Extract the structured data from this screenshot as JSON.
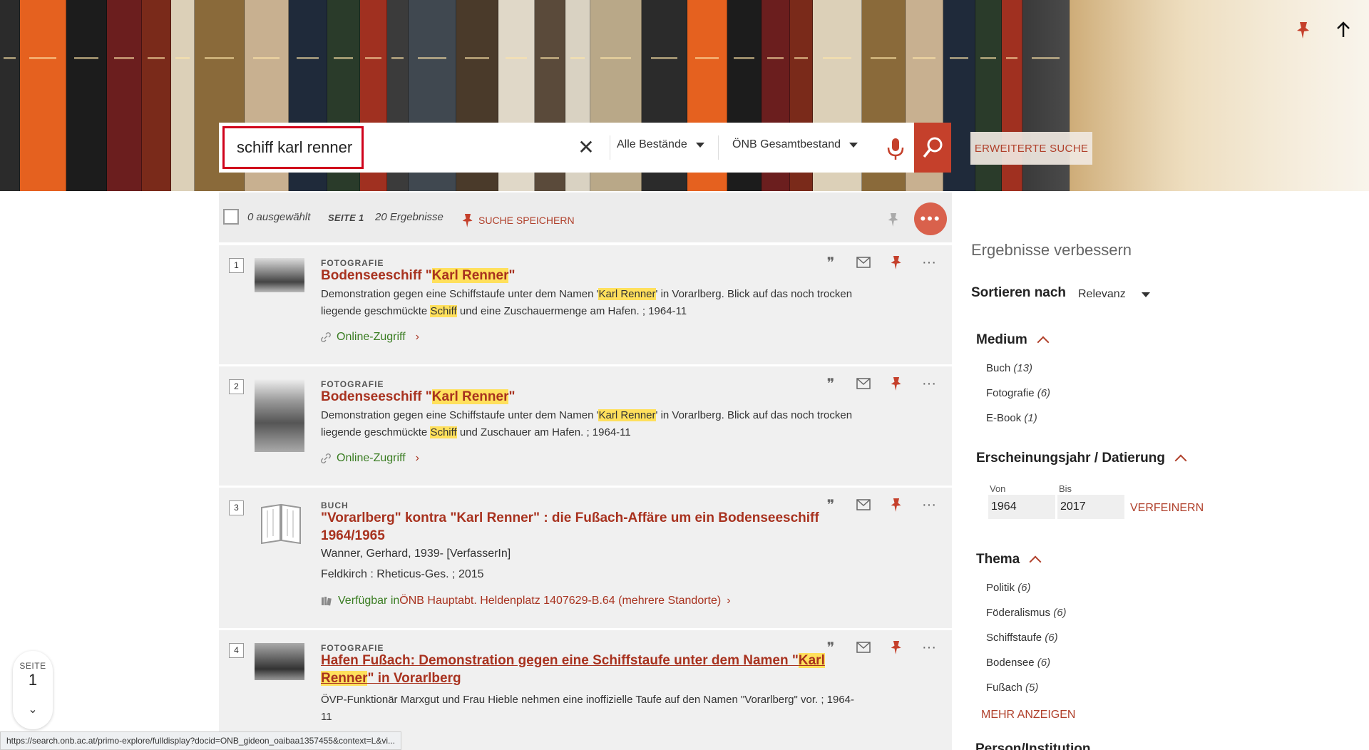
{
  "search": {
    "query": "schiff karl renner",
    "scope1": "Alle Bestände",
    "scope2": "ÖNB Gesamtbestand",
    "advanced_label": "ERWEITERTE SUCHE"
  },
  "toolbar": {
    "selected": "0 ausgewählt",
    "page": "SEITE 1",
    "count": "20 Ergebnisse",
    "save_search": "SUCHE SPEICHERN"
  },
  "results": [
    {
      "num": "1",
      "type": "FOTOGRAFIE",
      "title_pre": "Bodenseeschiff \"",
      "title_hl": "Karl Renner",
      "title_post": "\"",
      "desc1_pre": "Demonstration gegen eine Schiffstaufe unter dem Namen '",
      "desc1_hl": "Karl Renner",
      "desc1_post": "' in Vorarlberg. Blick auf das noch trocken",
      "desc2_pre": "liegende geschmückte ",
      "desc2_hl": "Schiff",
      "desc2_post": " und eine Zuschauermenge am Hafen. ; 1964-11",
      "link": "Online-Zugriff"
    },
    {
      "num": "2",
      "type": "FOTOGRAFIE",
      "title_pre": "Bodenseeschiff \"",
      "title_hl": "Karl Renner",
      "title_post": "\"",
      "desc1_pre": "Demonstration gegen eine Schiffstaufe unter dem Namen '",
      "desc1_hl": "Karl Renner",
      "desc1_post": "' in Vorarlberg. Blick auf das noch trocken",
      "desc2_pre": "liegende geschmückte ",
      "desc2_hl": "Schiff",
      "desc2_post": " und Zuschauer am Hafen. ; 1964-11",
      "link": "Online-Zugriff"
    },
    {
      "num": "3",
      "type": "BUCH",
      "title_line1": "\"Vorarlberg\" kontra \"Karl Renner\" : die Fußach-Affäre um ein Bodenseeschiff",
      "title_line2": "1964/1965",
      "author": "Wanner, Gerhard, 1939- [VerfasserIn]",
      "publisher": "Feldkirch : Rheticus-Ges. ; 2015",
      "avail_pre": "Verfügbar in ",
      "avail_loc": "ÖNB Hauptabt. Heldenplatz  1407629-B.64 (mehrere Standorte)"
    },
    {
      "num": "4",
      "type": "FOTOGRAFIE",
      "title_line1_pre": "Hafen Fußach: Demonstration gegen eine Schiffstaufe unter dem Namen \"",
      "title_line1_hl": "Karl",
      "title_line2_hl": "Renner",
      "title_line2_post": "\" in Vorarlberg",
      "desc1": "ÖVP-Funktionär Marxgut und Frau Hieble nehmen eine inoffizielle Taufe auf den Namen \"Vorarlberg\" vor. ; 1964-",
      "desc2": "11"
    }
  ],
  "facets": {
    "title": "Ergebnisse verbessern",
    "sort_label": "Sortieren nach",
    "sort_value": "Relevanz",
    "medium_title": "Medium",
    "medium": [
      {
        "label": "Buch",
        "count": "(13)"
      },
      {
        "label": "Fotografie",
        "count": "(6)"
      },
      {
        "label": "E-Book",
        "count": "(1)"
      }
    ],
    "year_title": "Erscheinungsjahr / Datierung",
    "year_from_label": "Von",
    "year_to_label": "Bis",
    "year_from": "1964",
    "year_to": "2017",
    "refine": "VERFEINERN",
    "thema_title": "Thema",
    "thema": [
      {
        "label": "Politik",
        "count": "(6)"
      },
      {
        "label": "Föderalismus",
        "count": "(6)"
      },
      {
        "label": "Schiffstaufe",
        "count": "(6)"
      },
      {
        "label": "Bodensee",
        "count": "(6)"
      },
      {
        "label": "Fußach",
        "count": "(5)"
      }
    ],
    "more": "MEHR ANZEIGEN",
    "next_heading": "Person/Institution"
  },
  "page_indicator": {
    "label": "SEITE",
    "num": "1"
  },
  "status_url": "https://search.onb.ac.at/primo-explore/fulldisplay?docid=ONB_gideon_oaibaa1357455&context=L&vi...",
  "colors": {
    "accent": "#a8321f",
    "highlight": "#ffe05c",
    "available": "#3a7d22"
  }
}
